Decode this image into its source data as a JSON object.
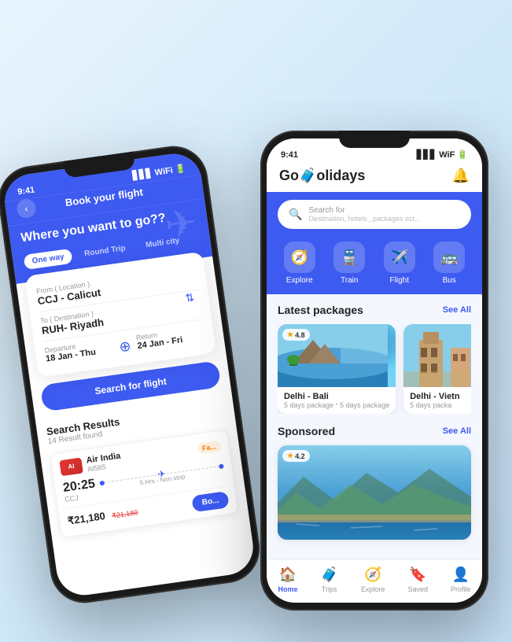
{
  "back_phone": {
    "status_time": "9:41",
    "header_title": "Book your flight",
    "tagline": "Where you want to go??",
    "trip_tabs": [
      "One way",
      "Round Trip",
      "Multi city"
    ],
    "active_tab": "One way",
    "from_label": "From ( Location )",
    "from_value": "CCJ - Calicut",
    "to_label": "To ( Destination )",
    "to_value": "RUH- Riyadh",
    "departure_label": "Departure",
    "departure_value": "18 Jan - Thu",
    "return_label": "Return",
    "return_value": "24 Jan - Fri",
    "search_btn": "Search for flight",
    "results_title": "Search Results",
    "results_count": "14 Result found",
    "flight": {
      "airline": "Air India",
      "code": "AI585",
      "fare_type": "Fa...",
      "dep_time": "20:25",
      "dep_airport": "CCJ",
      "duration": "5 Hrs - Non stop",
      "price": "₹21,180",
      "price_old": "₹21,180",
      "book_btn": "Bo..."
    }
  },
  "front_phone": {
    "status_time": "9:41",
    "logo_go": "Go",
    "logo_holidays": "Holidays",
    "search_label": "Search for",
    "search_placeholder": "Destination, hotels , packages ect...",
    "categories": [
      {
        "icon": "🧭",
        "label": "Explore"
      },
      {
        "icon": "🚆",
        "label": "Train"
      },
      {
        "icon": "✈️",
        "label": "Flight"
      },
      {
        "icon": "🚌",
        "label": "Bus"
      }
    ],
    "latest_packages_title": "Latest packages",
    "see_all_1": "See All",
    "packages": [
      {
        "name": "Delhi - Bali",
        "duration1": "5 days package",
        "duration2": "5 days package",
        "rating": "4.8"
      },
      {
        "name": "Delhi - Vietn",
        "duration1": "5 days packa",
        "rating": ""
      }
    ],
    "sponsored_title": "Sponsored",
    "see_all_2": "See All",
    "sponsored_rating": "4.2",
    "bottom_nav": [
      {
        "icon": "🏠",
        "label": "Home",
        "active": true
      },
      {
        "icon": "🧳",
        "label": "Trips",
        "active": false
      },
      {
        "icon": "🧭",
        "label": "Explore",
        "active": false
      },
      {
        "icon": "🔖",
        "label": "Saved",
        "active": false
      },
      {
        "icon": "👤",
        "label": "Profile",
        "active": false
      }
    ]
  }
}
